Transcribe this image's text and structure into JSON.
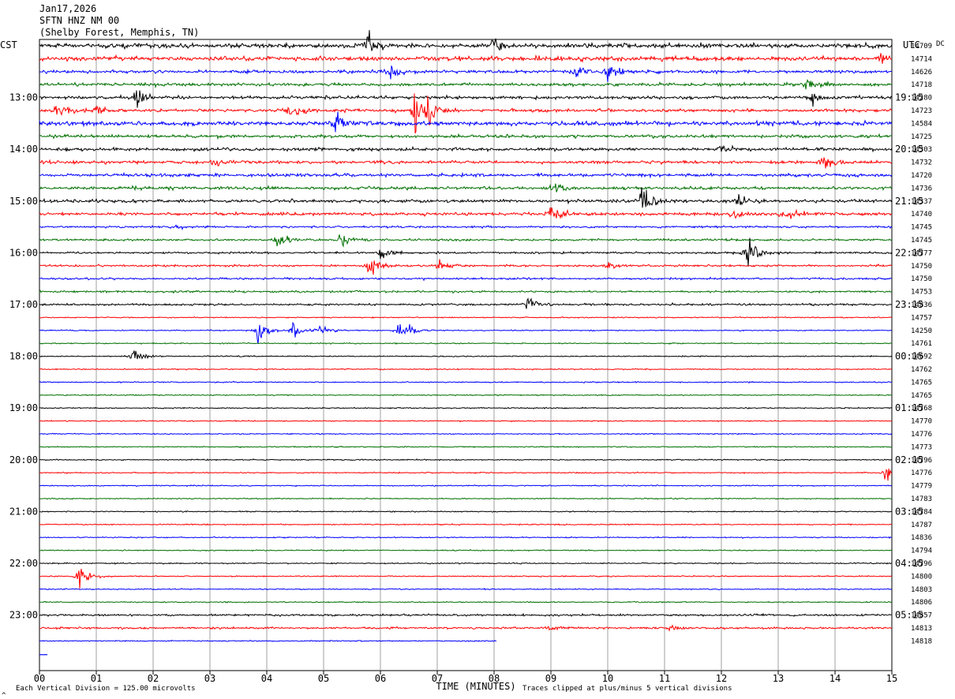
{
  "header": {
    "date": "Jan17,2026",
    "station": "SFTN HNZ NM 00",
    "location": "(Shelby Forest, Memphis, TN)"
  },
  "cst_label": "CST",
  "utc_label": "UTC",
  "dc_label": "DC",
  "footer": {
    "scale_note": "Each Vertical Division =  125.00 microvolts",
    "clip_note": "Traces clipped at plus/minus 5 vertical divisions",
    "corner_mark": "^"
  },
  "chart_data": {
    "type": "line",
    "xlabel": "TIME (MINUTES)",
    "x_ticks": [
      "00",
      "01",
      "02",
      "03",
      "04",
      "05",
      "06",
      "07",
      "08",
      "09",
      "10",
      "11",
      "12",
      "13",
      "14",
      "15"
    ],
    "xlim": [
      0,
      15
    ],
    "colors": [
      "#000000",
      "#ff0000",
      "#0000ff",
      "#007000"
    ],
    "rows_per_hour": 4,
    "cst_hour_labels": [
      "13:00",
      "14:00",
      "15:00",
      "16:00",
      "17:00",
      "18:00",
      "19:00",
      "20:00",
      "21:00",
      "22:00",
      "23:00"
    ],
    "utc_hour_labels": [
      "19:15",
      "20:15",
      "21:15",
      "22:15",
      "23:15",
      "00:15",
      "01:15",
      "02:15",
      "03:15",
      "04:15",
      "05:15"
    ],
    "dc_offsets": [
      14709,
      14714,
      14626,
      14718,
      14280,
      14723,
      14584,
      14725,
      14303,
      14732,
      14720,
      14736,
      14337,
      14740,
      14745,
      14745,
      14777,
      14750,
      14750,
      14753,
      14836,
      14757,
      14250,
      14761,
      14692,
      14762,
      14765,
      14765,
      14768,
      14770,
      14776,
      14773,
      14796,
      14776,
      14779,
      14783,
      14784,
      14787,
      14836,
      14794,
      14796,
      14800,
      14803,
      14806,
      14857,
      14813,
      14818
    ],
    "amplitude_levels": [
      3,
      3,
      2,
      2,
      2,
      2,
      3,
      2,
      2,
      2,
      2,
      2,
      2,
      2,
      1,
      1,
      1,
      1,
      1,
      1,
      1,
      0,
      0,
      0,
      0,
      0,
      0,
      0,
      0,
      0,
      0,
      0,
      0,
      0,
      0,
      0,
      0,
      0,
      0,
      0,
      0,
      0,
      0,
      0,
      1,
      1,
      0
    ],
    "events": [
      {
        "row": 0,
        "minute": 5.75,
        "size": 5
      },
      {
        "row": 0,
        "minute": 8.0,
        "size": 2
      },
      {
        "row": 1,
        "minute": 14.8,
        "size": 2
      },
      {
        "row": 2,
        "minute": 6.2,
        "size": 3
      },
      {
        "row": 2,
        "minute": 9.4,
        "size": 2
      },
      {
        "row": 2,
        "minute": 10.0,
        "size": 3
      },
      {
        "row": 3,
        "minute": 13.5,
        "size": 2
      },
      {
        "row": 4,
        "minute": 1.7,
        "size": 4
      },
      {
        "row": 4,
        "minute": 13.6,
        "size": 2
      },
      {
        "row": 5,
        "minute": 0.3,
        "size": 2
      },
      {
        "row": 5,
        "minute": 1.0,
        "size": 2
      },
      {
        "row": 5,
        "minute": 4.4,
        "size": 4
      },
      {
        "row": 5,
        "minute": 6.6,
        "size": 8
      },
      {
        "row": 5,
        "minute": 6.8,
        "size": 4
      },
      {
        "row": 6,
        "minute": 5.2,
        "size": 4
      },
      {
        "row": 8,
        "minute": 12.0,
        "size": 2
      },
      {
        "row": 9,
        "minute": 3.1,
        "size": 2
      },
      {
        "row": 9,
        "minute": 13.8,
        "size": 3
      },
      {
        "row": 11,
        "minute": 9.0,
        "size": 2
      },
      {
        "row": 12,
        "minute": 10.6,
        "size": 6
      },
      {
        "row": 12,
        "minute": 12.3,
        "size": 2
      },
      {
        "row": 13,
        "minute": 9.0,
        "size": 3
      },
      {
        "row": 13,
        "minute": 12.2,
        "size": 2
      },
      {
        "row": 13,
        "minute": 13.1,
        "size": 3
      },
      {
        "row": 14,
        "minute": 2.4,
        "size": 1
      },
      {
        "row": 15,
        "minute": 4.2,
        "size": 4
      },
      {
        "row": 15,
        "minute": 5.3,
        "size": 3
      },
      {
        "row": 16,
        "minute": 6.0,
        "size": 2
      },
      {
        "row": 16,
        "minute": 12.45,
        "size": 7
      },
      {
        "row": 17,
        "minute": 5.8,
        "size": 4
      },
      {
        "row": 17,
        "minute": 7.0,
        "size": 2
      },
      {
        "row": 17,
        "minute": 10.0,
        "size": 1
      },
      {
        "row": 20,
        "minute": 8.6,
        "size": 3
      },
      {
        "row": 22,
        "minute": 3.85,
        "size": 5
      },
      {
        "row": 22,
        "minute": 4.45,
        "size": 3
      },
      {
        "row": 22,
        "minute": 4.95,
        "size": 2
      },
      {
        "row": 22,
        "minute": 6.3,
        "size": 2
      },
      {
        "row": 22,
        "minute": 6.45,
        "size": 2
      },
      {
        "row": 24,
        "minute": 1.65,
        "size": 3
      },
      {
        "row": 33,
        "minute": 14.9,
        "size": 3
      },
      {
        "row": 41,
        "minute": 0.7,
        "size": 4
      },
      {
        "row": 45,
        "minute": 9.0,
        "size": 1
      },
      {
        "row": 45,
        "minute": 11.1,
        "size": 1
      }
    ],
    "last_row_end_minute": 8.05
  }
}
